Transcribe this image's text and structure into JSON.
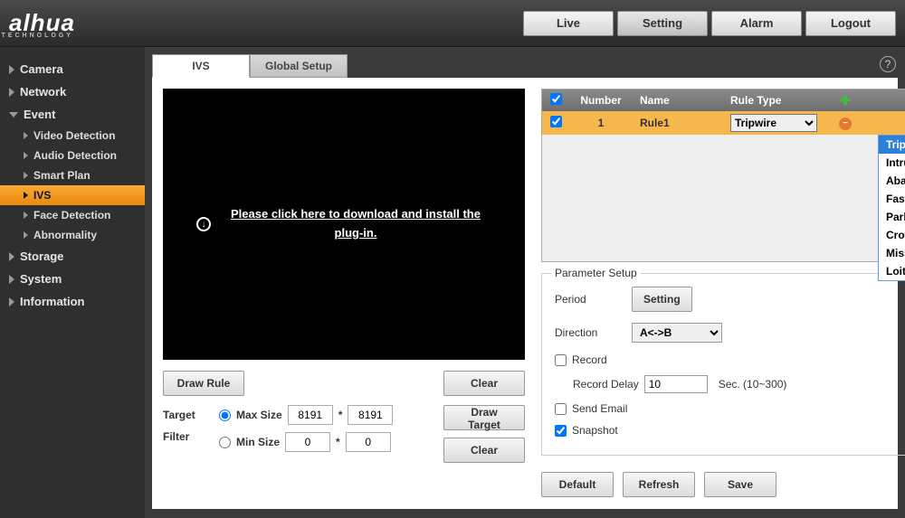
{
  "header": {
    "brand": "alhua",
    "brand_sub": "TECHNOLOGY",
    "nav": {
      "live": "Live",
      "setting": "Setting",
      "alarm": "Alarm",
      "logout": "Logout"
    }
  },
  "sidebar": {
    "camera": "Camera",
    "network": "Network",
    "event": "Event",
    "event_items": {
      "video_detection": "Video Detection",
      "audio_detection": "Audio Detection",
      "smart_plan": "Smart Plan",
      "ivs": "IVS",
      "face_detection": "Face Detection",
      "abnormality": "Abnormality"
    },
    "storage": "Storage",
    "system": "System",
    "information": "Information"
  },
  "tabs": {
    "ivs": "IVS",
    "global_setup": "Global Setup"
  },
  "video": {
    "message": "Please click here to download and install the plug-in."
  },
  "controls": {
    "draw_rule": "Draw Rule",
    "clear": "Clear",
    "draw_target": "Draw Target",
    "target_filter": "Target Filter",
    "target": "Target",
    "filter": "Filter",
    "max_size": "Max Size",
    "min_size": "Min Size",
    "max_w": "8191",
    "max_h": "8191",
    "min_w": "0",
    "min_h": "0"
  },
  "rules": {
    "headers": {
      "number": "Number",
      "name": "Name",
      "rule_type": "Rule Type"
    },
    "row": {
      "number": "1",
      "name": "Rule1",
      "type": "Tripwire"
    },
    "options": [
      "Tripwire",
      "Intrusion",
      "Abandoned Object",
      "Fast-Moving",
      "Parking Detection",
      "Crowd Gathering Estimation",
      "Missing Object",
      "Loitering Detection"
    ]
  },
  "params": {
    "legend": "Parameter Setup",
    "period": "Period",
    "setting": "Setting",
    "direction": "Direction",
    "direction_value": "A<->B",
    "record": "Record",
    "record_delay": "Record Delay",
    "record_delay_value": "10",
    "record_delay_unit": "Sec. (10~300)",
    "send_email": "Send Email",
    "snapshot": "Snapshot"
  },
  "buttons": {
    "default": "Default",
    "refresh": "Refresh",
    "save": "Save"
  }
}
